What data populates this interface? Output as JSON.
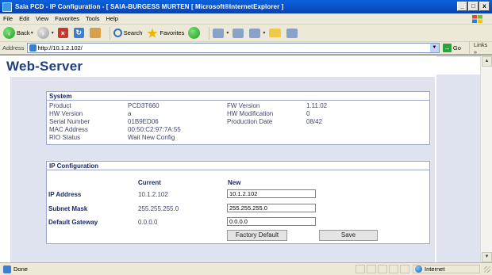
{
  "window": {
    "title": "Saia PCD - IP Configuration - [ SAIA-BURGESS MURTEN [ Microsoft®InternetExplorer ]",
    "minimize": "_",
    "maximize": "□",
    "close": "x"
  },
  "menu": [
    "File",
    "Edit",
    "View",
    "Favorites",
    "Tools",
    "Help"
  ],
  "toolbar": {
    "back": "Back",
    "search": "Search",
    "favorites": "Favorites"
  },
  "address": {
    "label": "Address",
    "url": "http://10.1.2.102/",
    "go": "Go",
    "links": "Links"
  },
  "page": {
    "title": "Web-Server",
    "system": {
      "heading": "System",
      "rows": [
        {
          "label": "Product",
          "value": "PCD3T660"
        },
        {
          "label": "HW Version",
          "value": "a"
        },
        {
          "label": "Serial Number",
          "value": "01B9ED06"
        },
        {
          "label": "MAC Address",
          "value": "00:50:C2:97:7A:55"
        },
        {
          "label": "RIO Status",
          "value": "Wait New Config"
        }
      ],
      "right_rows": [
        {
          "label": "FW Version",
          "value": "1.11.02"
        },
        {
          "label": "HW Modification",
          "value": "0"
        },
        {
          "label": "Production Date",
          "value": "08/42"
        }
      ]
    },
    "ip": {
      "heading": "IP Configuration",
      "col_current": "Current",
      "col_new": "New",
      "rows": [
        {
          "label": "IP Address",
          "current": "10.1.2.102",
          "new": "10.1.2.102"
        },
        {
          "label": "Subnet Mask",
          "current": "255.255.255.0",
          "new": "255.255.255.0"
        },
        {
          "label": "Default Gateway",
          "current": "0.0.0.0",
          "new": "0.0.0.0"
        }
      ],
      "factory_default": "Factory Default",
      "save": "Save"
    }
  },
  "status": {
    "text": "Done",
    "zone": "Internet"
  }
}
